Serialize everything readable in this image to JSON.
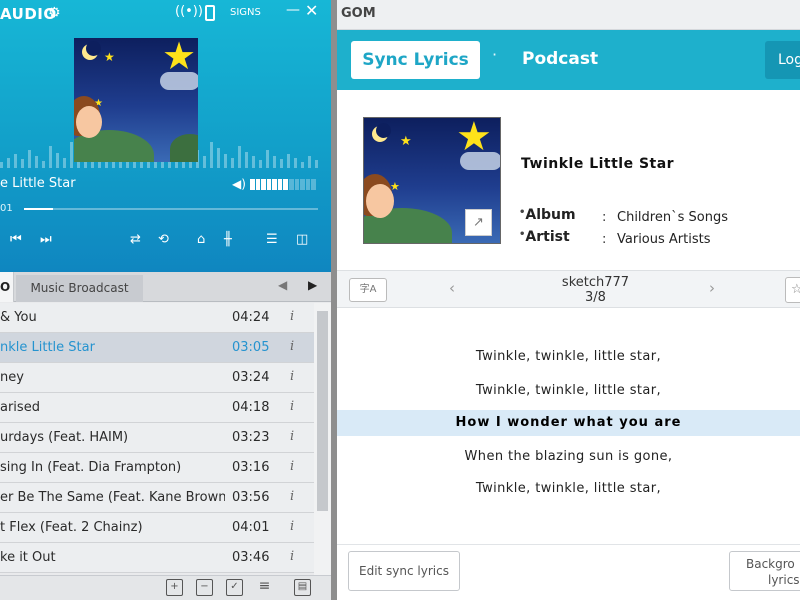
{
  "player": {
    "app_title": "AUDIO",
    "user_name": "SIGNS",
    "minimize": "—",
    "close": "✕",
    "now_playing": {
      "title": "e Little Star",
      "time": "01",
      "progress": 0.1,
      "volume": 0.55
    },
    "tabs": {
      "first": "O",
      "broadcast": "Music Broadcast"
    },
    "playlist": [
      {
        "title": "& You",
        "duration": "04:24",
        "info": "i",
        "active": false
      },
      {
        "title": "nkle Little Star",
        "duration": "03:05",
        "info": "i",
        "active": true
      },
      {
        "title": "ney",
        "duration": "03:24",
        "info": "i",
        "active": false
      },
      {
        "title": "arised",
        "duration": "04:18",
        "info": "i",
        "active": false
      },
      {
        "title": "urdays (Feat. HAIM)",
        "duration": "03:23",
        "info": "i",
        "active": false
      },
      {
        "title": "sing In (Feat. Dia Frampton)",
        "duration": "03:16",
        "info": "i",
        "active": false
      },
      {
        "title": "er Be The Same (Feat. Kane Brown)",
        "duration": "03:56",
        "info": "i",
        "active": false
      },
      {
        "title": "t Flex (Feat. 2 Chainz)",
        "duration": "04:01",
        "info": "i",
        "active": false
      },
      {
        "title": "ke it Out",
        "duration": "03:46",
        "info": "i",
        "active": false
      }
    ]
  },
  "lyrics_window": {
    "app_name": "GOM",
    "tabs": {
      "sync_lyrics": "Sync Lyrics",
      "separator": "·",
      "podcast": "Podcast",
      "login": "Log"
    },
    "song": {
      "title": "Twinkle Little Star",
      "album_label": "Album",
      "album": "Children`s Songs",
      "artist_label": "Artist",
      "artist": "Various Artists",
      "colon": ":"
    },
    "toolbar": {
      "author": "sketch777",
      "page": "3/8"
    },
    "lines": [
      {
        "text": "Twinkle, twinkle, little star,",
        "current": false
      },
      {
        "text": "Twinkle, twinkle, little star,",
        "current": false
      },
      {
        "text": "How I wonder what you are",
        "current": true
      },
      {
        "text": "When the blazing sun is gone,",
        "current": false
      },
      {
        "text": "Twinkle, twinkle, little star,",
        "current": false
      }
    ],
    "footer": {
      "edit_sync": "Edit sync lyrics",
      "background_line1": "Backgro",
      "background_line2": "lyrics"
    }
  },
  "colors": {
    "player_accent": "#17b7d6",
    "active_track": "#2593cf",
    "lyrics_header": "#1eb0cc",
    "current_line_bg": "#d9eaf7"
  },
  "icons": [
    "settings-icon",
    "broadcast-icon",
    "phone-icon",
    "volume-icon",
    "share-icon",
    "translate-icon",
    "bookmark-icon"
  ]
}
